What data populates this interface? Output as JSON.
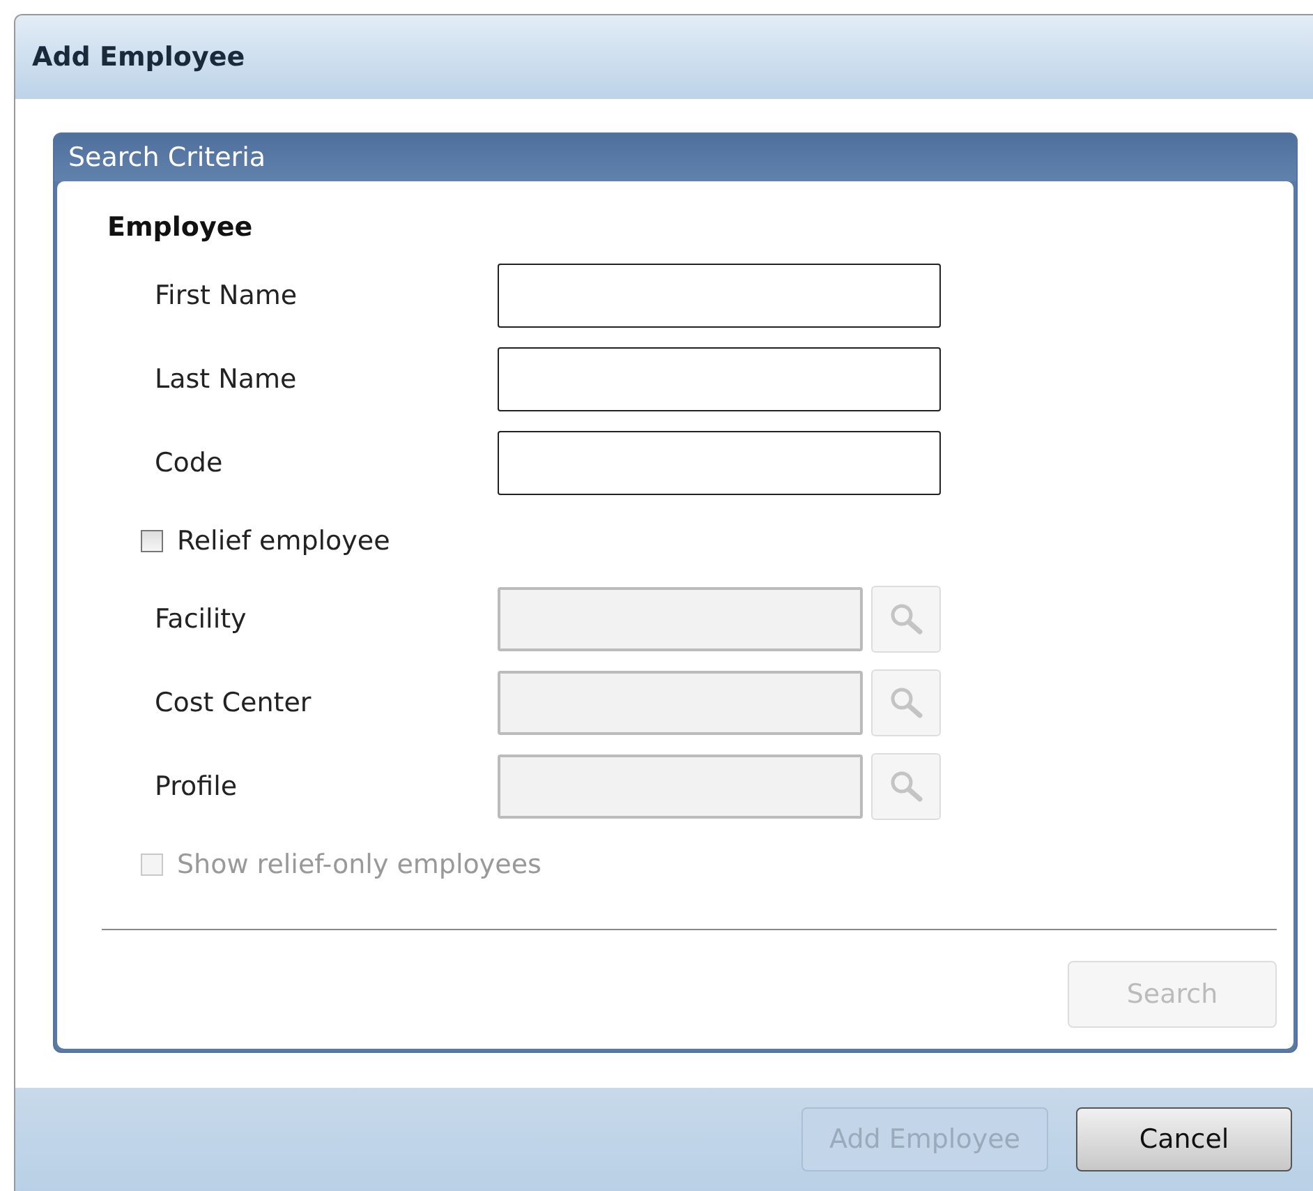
{
  "window": {
    "title": "Add Employee"
  },
  "panel": {
    "title": "Search Criteria",
    "section": "Employee",
    "rows": [
      {
        "kind": "text",
        "label": "First Name",
        "disabled": false
      },
      {
        "kind": "text",
        "label": "Last Name",
        "disabled": false
      },
      {
        "kind": "text",
        "label": "Code",
        "disabled": false
      },
      {
        "kind": "checkbox",
        "label": "Relief employee",
        "checked": false,
        "disabled": false
      },
      {
        "kind": "lookup",
        "label": "Facility",
        "disabled": true
      },
      {
        "kind": "lookup",
        "label": "Cost Center",
        "disabled": true
      },
      {
        "kind": "lookup",
        "label": "Profile",
        "disabled": true
      },
      {
        "kind": "checkbox",
        "label": "Show relief-only employees",
        "checked": false,
        "disabled": true
      }
    ],
    "search_button": {
      "label": "Search",
      "disabled": true
    }
  },
  "buttons": [
    {
      "label": "Add Employee",
      "disabled": true
    },
    {
      "label": "Cancel",
      "disabled": false
    }
  ]
}
